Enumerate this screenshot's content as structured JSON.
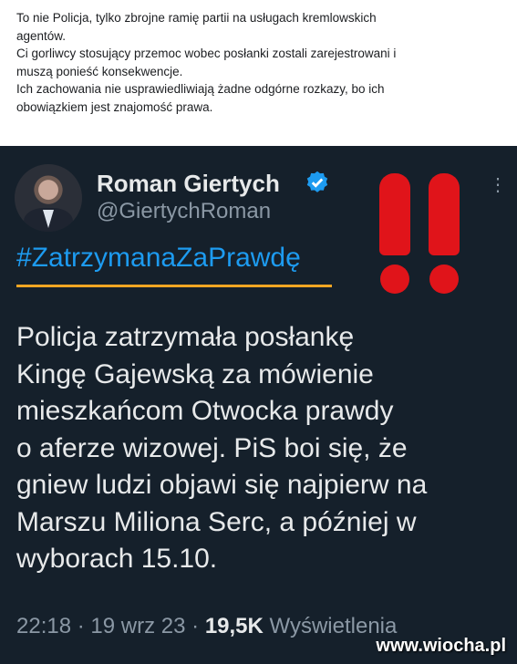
{
  "post": {
    "lines": [
      "To nie Policja, tylko zbrojne ramię partii na usługach kremlowskich",
      "agentów.",
      "Ci gorliwcy stosujący przemoc wobec posłanki zostali zarejestrowani i",
      "muszą ponieść konsekwencje.",
      "Ich zachowania nie usprawiedliwiają żadne odgórne rozkazy, bo ich",
      "obowiązkiem jest znajomość prawa."
    ]
  },
  "tweet": {
    "author_name": "Roman Giertych",
    "author_handle": "@GiertychRoman",
    "more_icon": "more-dots-icon",
    "verified_icon": "verified-badge-icon",
    "hashtag": "#ZatrzymanaZaPrawdę",
    "body_lines": [
      "Policja zatrzymała posłankę",
      "Kingę Gajewską za mówienie",
      "mieszkańcom Otwocka prawdy",
      "o aferze wizowej. PiS boi się, że",
      "gniew ludzi objawi się najpierw na",
      "Marszu Miliona Serc, a później w",
      "wyborach 15.10."
    ],
    "time": "22:18",
    "date": "19 wrz 23",
    "views_count": "19,5K",
    "views_label": "Wyświetlenia",
    "separator": "·"
  },
  "overlay": {
    "exclamation_marks": "!!",
    "watermark": "www.wiocha.pl"
  },
  "colors": {
    "tweet_bg": "#15202b",
    "hashtag": "#1d9bf0",
    "exclamation": "#e0141a",
    "underline": "#f5a623"
  }
}
